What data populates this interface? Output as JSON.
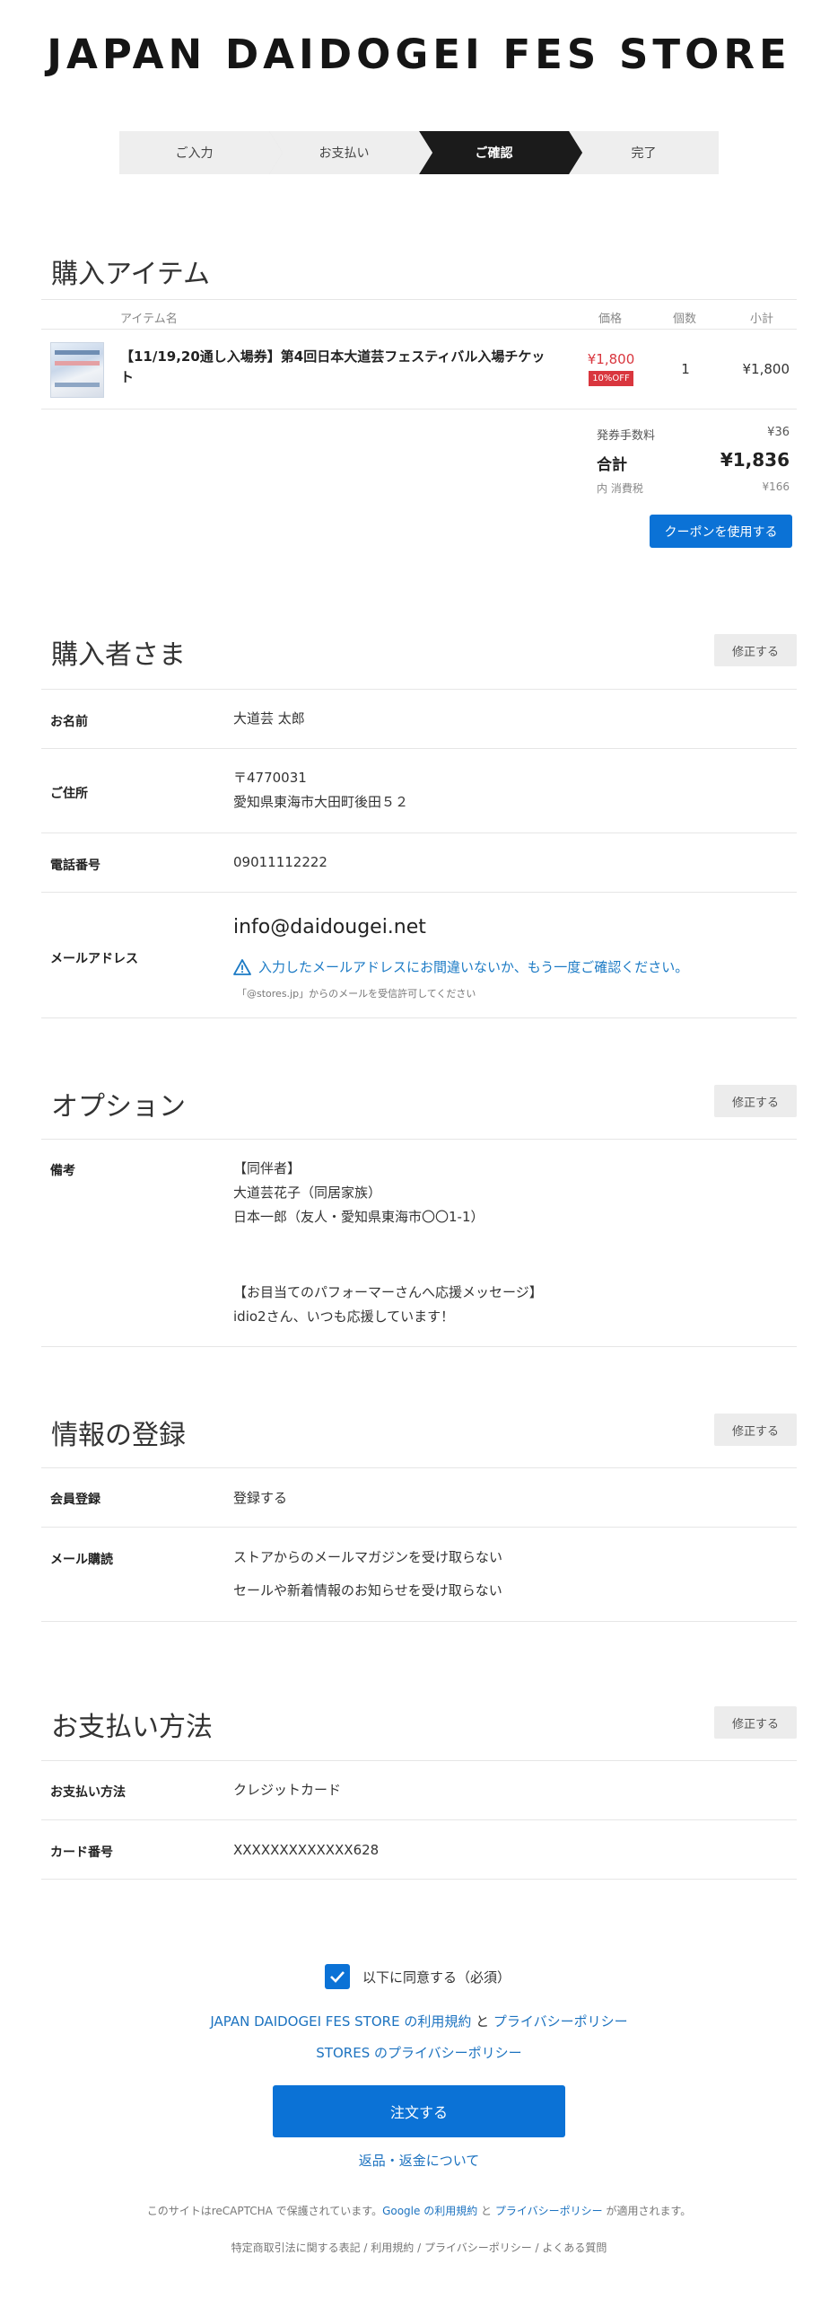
{
  "store": {
    "title": "JAPAN DAIDOGEI FES STORE"
  },
  "steps": [
    "ご入力",
    "お支払い",
    "ご確認",
    "完了"
  ],
  "items_section": {
    "title": "購入アイテム",
    "headers": {
      "name": "アイテム名",
      "price": "価格",
      "qty": "個数",
      "subtotal": "小計"
    },
    "item": {
      "name": "【11/19,20通し入場券】第4回日本大道芸フェスティバル入場チケット",
      "price": "¥1,800",
      "discount": "10%OFF",
      "qty": "1",
      "subtotal": "¥1,800"
    },
    "fee_label": "発券手数料",
    "fee_value": "¥36",
    "total_label": "合計",
    "total_value": "¥1,836",
    "tax_label": "内 消費税",
    "tax_value": "¥166",
    "coupon_button": "クーポンを使用する"
  },
  "buyer": {
    "title": "購入者さま",
    "edit": "修正する",
    "name_label": "お名前",
    "name_value": "大道芸 太郎",
    "address_label": "ご住所",
    "postal": "〒4770031",
    "address": "愛知県東海市大田町後田５２",
    "phone_label": "電話番号",
    "phone_value": "09011112222",
    "email_label": "メールアドレス",
    "email_value": "info@daidougei.net",
    "email_warning": "入力したメールアドレスにお間違いないか、もう一度ご確認ください。",
    "email_note": "「@stores.jp」からのメールを受信許可してください"
  },
  "options": {
    "title": "オプション",
    "edit": "修正する",
    "remarks_label": "備考",
    "remarks_lines": [
      "【同伴者】",
      "大道芸花子（同居家族）",
      "日本一郎（友人・愛知県東海市〇〇1-1）",
      "【お目当てのパフォーマーさんへ応援メッセージ】",
      "idio2さん、いつも応援しています！"
    ]
  },
  "registration": {
    "title": "情報の登録",
    "edit": "修正する",
    "member_label": "会員登録",
    "member_value": "登録する",
    "mail_label": "メール購読",
    "mail_value_1": "ストアからのメールマガジンを受け取らない",
    "mail_value_2": "セールや新着情報のお知らせを受け取らない"
  },
  "payment": {
    "title": "お支払い方法",
    "edit": "修正する",
    "method_label": "お支払い方法",
    "method_value": "クレジットカード",
    "card_label": "カード番号",
    "card_value": "XXXXXXXXXXXXX628"
  },
  "agreement": {
    "label": "以下に同意する（必須）",
    "terms_link": "JAPAN DAIDOGEI FES STORE の利用規約",
    "and": "と",
    "privacy_link": "プライバシーポリシー",
    "stores_privacy": "STORES のプライバシーポリシー"
  },
  "order_button": "注文する",
  "refund_link": "返品・返金について",
  "recaptcha": {
    "prefix": "このサイトはreCAPTCHA で保護されています。",
    "google_terms": "Google の利用規約",
    "and": "と",
    "privacy": "プライバシーポリシー",
    "suffix": "が適用されます。"
  },
  "footer": "特定商取引法に関する表記 / 利用規約 / プライバシーポリシー / よくある質問",
  "colors": {
    "accent": "#0b72d6",
    "sale": "#d9363e",
    "link": "#1d73c0"
  }
}
